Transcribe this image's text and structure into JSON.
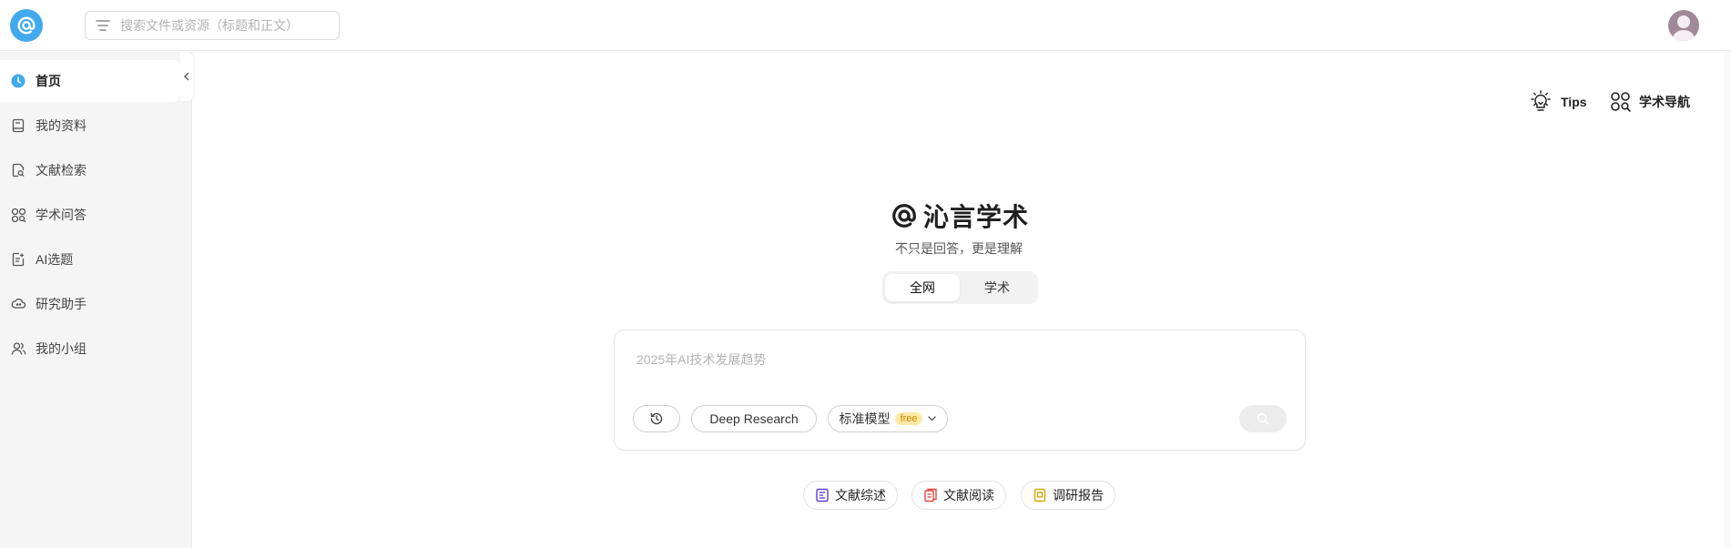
{
  "header": {
    "search_placeholder": "搜索文件或资源（标题和正文）"
  },
  "sidebar": {
    "items": [
      {
        "label": "首页",
        "icon": "home-clock-icon",
        "active": true
      },
      {
        "label": "我的资料",
        "icon": "book-icon",
        "active": false
      },
      {
        "label": "文献检索",
        "icon": "doc-search-icon",
        "active": false
      },
      {
        "label": "学术问答",
        "icon": "grid-search-icon",
        "active": false
      },
      {
        "label": "AI选题",
        "icon": "doc-edit-icon",
        "active": false
      },
      {
        "label": "研究助手",
        "icon": "cloud-icon",
        "active": false
      },
      {
        "label": "我的小组",
        "icon": "group-icon",
        "active": false
      }
    ]
  },
  "tools": {
    "tips_label": "Tips",
    "nav_label": "学术导航"
  },
  "main": {
    "brand": "沁言学术",
    "slogan": "不只是回答，更是理解",
    "tabs": [
      {
        "label": "全网",
        "active": true
      },
      {
        "label": "学术",
        "active": false
      }
    ],
    "query_placeholder": "2025年AI技术发展趋势",
    "deep_research_label": "Deep Research",
    "model_label": "标准模型",
    "model_badge": "free",
    "quick_actions": [
      {
        "label": "文献综述",
        "icon": "review-icon"
      },
      {
        "label": "文献阅读",
        "icon": "reading-icon"
      },
      {
        "label": "调研报告",
        "icon": "report-icon"
      }
    ]
  },
  "colors": {
    "accent": "#41a9ee",
    "badge_bg": "#ffe9a8",
    "badge_text": "#c98a00"
  }
}
